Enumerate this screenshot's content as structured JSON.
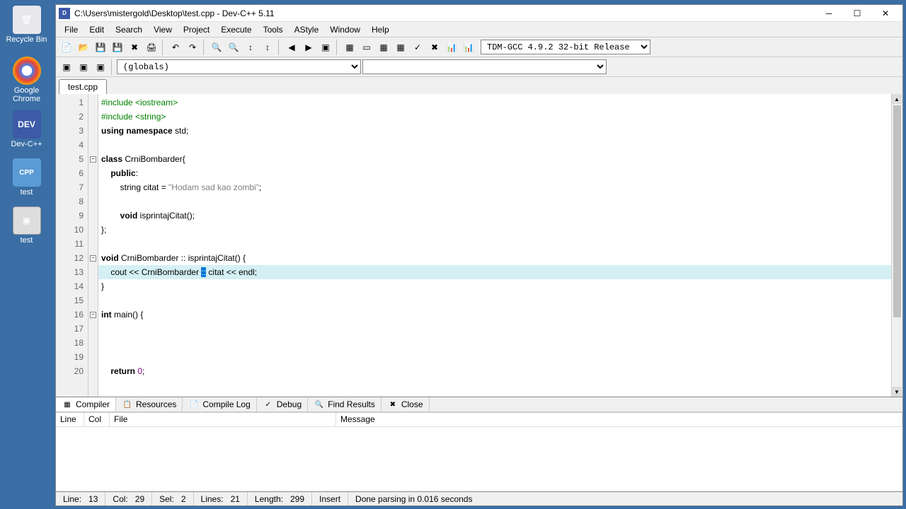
{
  "desktop_icons": [
    {
      "label": "Recycle Bin",
      "color": "#e0e0e0"
    },
    {
      "label": "Google Chrome",
      "color": "#4285f4"
    },
    {
      "label": "Dev-C++",
      "color": "#3c5aa6"
    },
    {
      "label": "test",
      "color": "#5b9bd5"
    },
    {
      "label": "test",
      "color": "#808080"
    }
  ],
  "window": {
    "title": "C:\\Users\\mistergold\\Desktop\\test.cpp - Dev-C++ 5.11"
  },
  "menu": [
    "File",
    "Edit",
    "Search",
    "View",
    "Project",
    "Execute",
    "Tools",
    "AStyle",
    "Window",
    "Help"
  ],
  "compiler_dropdown": "TDM-GCC 4.9.2 32-bit Release",
  "scope_dropdown": "(globals)",
  "tab": "test.cpp",
  "code_lines": [
    {
      "n": 1,
      "fold": "",
      "tokens": [
        {
          "t": "#include ",
          "c": "pp"
        },
        {
          "t": "<iostream>",
          "c": "pp"
        }
      ]
    },
    {
      "n": 2,
      "fold": "",
      "tokens": [
        {
          "t": "#include ",
          "c": "pp"
        },
        {
          "t": "<string>",
          "c": "pp"
        }
      ]
    },
    {
      "n": 3,
      "fold": "",
      "tokens": [
        {
          "t": "using namespace",
          "c": "kw"
        },
        {
          "t": " std;",
          "c": ""
        }
      ]
    },
    {
      "n": 4,
      "fold": "",
      "tokens": []
    },
    {
      "n": 5,
      "fold": "-",
      "tokens": [
        {
          "t": "class",
          "c": "kw"
        },
        {
          "t": " CrniBombarder{",
          "c": ""
        }
      ]
    },
    {
      "n": 6,
      "fold": "",
      "tokens": [
        {
          "t": "    ",
          "c": ""
        },
        {
          "t": "public",
          "c": "kw"
        },
        {
          "t": ":",
          "c": ""
        }
      ]
    },
    {
      "n": 7,
      "fold": "",
      "tokens": [
        {
          "t": "        string citat = ",
          "c": ""
        },
        {
          "t": "\"Hodam sad kao zombi\"",
          "c": "str"
        },
        {
          "t": ";",
          "c": ""
        }
      ]
    },
    {
      "n": 8,
      "fold": "",
      "tokens": []
    },
    {
      "n": 9,
      "fold": "",
      "tokens": [
        {
          "t": "        ",
          "c": ""
        },
        {
          "t": "void",
          "c": "kw"
        },
        {
          "t": " isprintajCitat();",
          "c": ""
        }
      ]
    },
    {
      "n": 10,
      "fold": "",
      "tokens": [
        {
          "t": "};",
          "c": ""
        }
      ]
    },
    {
      "n": 11,
      "fold": "",
      "tokens": []
    },
    {
      "n": 12,
      "fold": "-",
      "tokens": [
        {
          "t": "void",
          "c": "kw"
        },
        {
          "t": " CrniBombarder :: isprintajCitat() {",
          "c": ""
        }
      ]
    },
    {
      "n": 13,
      "fold": "",
      "hl": true,
      "tokens": [
        {
          "t": "    cout << CrniBombarder ",
          "c": ""
        },
        {
          "t": "::",
          "c": "sel"
        },
        {
          "t": " citat << endl;",
          "c": ""
        }
      ]
    },
    {
      "n": 14,
      "fold": "",
      "tokens": [
        {
          "t": "}",
          "c": ""
        }
      ]
    },
    {
      "n": 15,
      "fold": "",
      "tokens": []
    },
    {
      "n": 16,
      "fold": "-",
      "tokens": [
        {
          "t": "int",
          "c": "kw"
        },
        {
          "t": " main() {",
          "c": ""
        }
      ]
    },
    {
      "n": 17,
      "fold": "",
      "tokens": []
    },
    {
      "n": 18,
      "fold": "",
      "tokens": []
    },
    {
      "n": 19,
      "fold": "",
      "tokens": []
    },
    {
      "n": 20,
      "fold": "",
      "tokens": [
        {
          "t": "    ",
          "c": ""
        },
        {
          "t": "return",
          "c": "kw"
        },
        {
          "t": " ",
          "c": ""
        },
        {
          "t": "0",
          "c": "num"
        },
        {
          "t": ";",
          "c": ""
        }
      ]
    }
  ],
  "bottom_tabs": [
    "Compiler",
    "Resources",
    "Compile Log",
    "Debug",
    "Find Results",
    "Close"
  ],
  "compiler_cols": [
    "Line",
    "Col",
    "File",
    "Message"
  ],
  "status": {
    "line_label": "Line:",
    "line": "13",
    "col_label": "Col:",
    "col": "29",
    "sel_label": "Sel:",
    "sel": "2",
    "lines_label": "Lines:",
    "lines": "21",
    "length_label": "Length:",
    "length": "299",
    "mode": "Insert",
    "parse": "Done parsing in 0.016 seconds"
  }
}
